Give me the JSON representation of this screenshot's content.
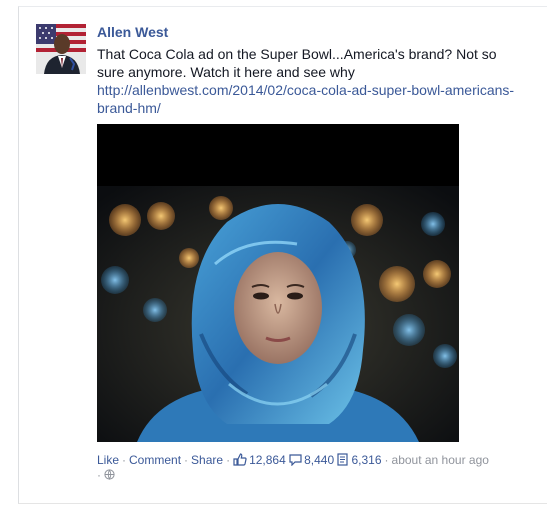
{
  "post": {
    "author": "Allen West",
    "text": "That Coca Cola ad on the Super Bowl...America's brand? Not so sure anymore. Watch it here and see why",
    "link": "http://allenbwest.com/2014/02/coca-cola-ad-super-bowl-americans-brand-hm/",
    "actions": {
      "like": "Like",
      "comment": "Comment",
      "share": "Share"
    },
    "counts": {
      "likes": "12,864",
      "comments": "8,440",
      "shares": "6,316"
    },
    "timestamp": "about an hour ago",
    "separator": "·"
  },
  "icons": {
    "like": "thumbs-up-icon",
    "comment": "speech-bubble-icon",
    "share": "share-icon",
    "audience": "globe-icon"
  },
  "colors": {
    "link_blue": "#3b5998",
    "meta_gray": "#90949c",
    "body_text": "#141823"
  }
}
